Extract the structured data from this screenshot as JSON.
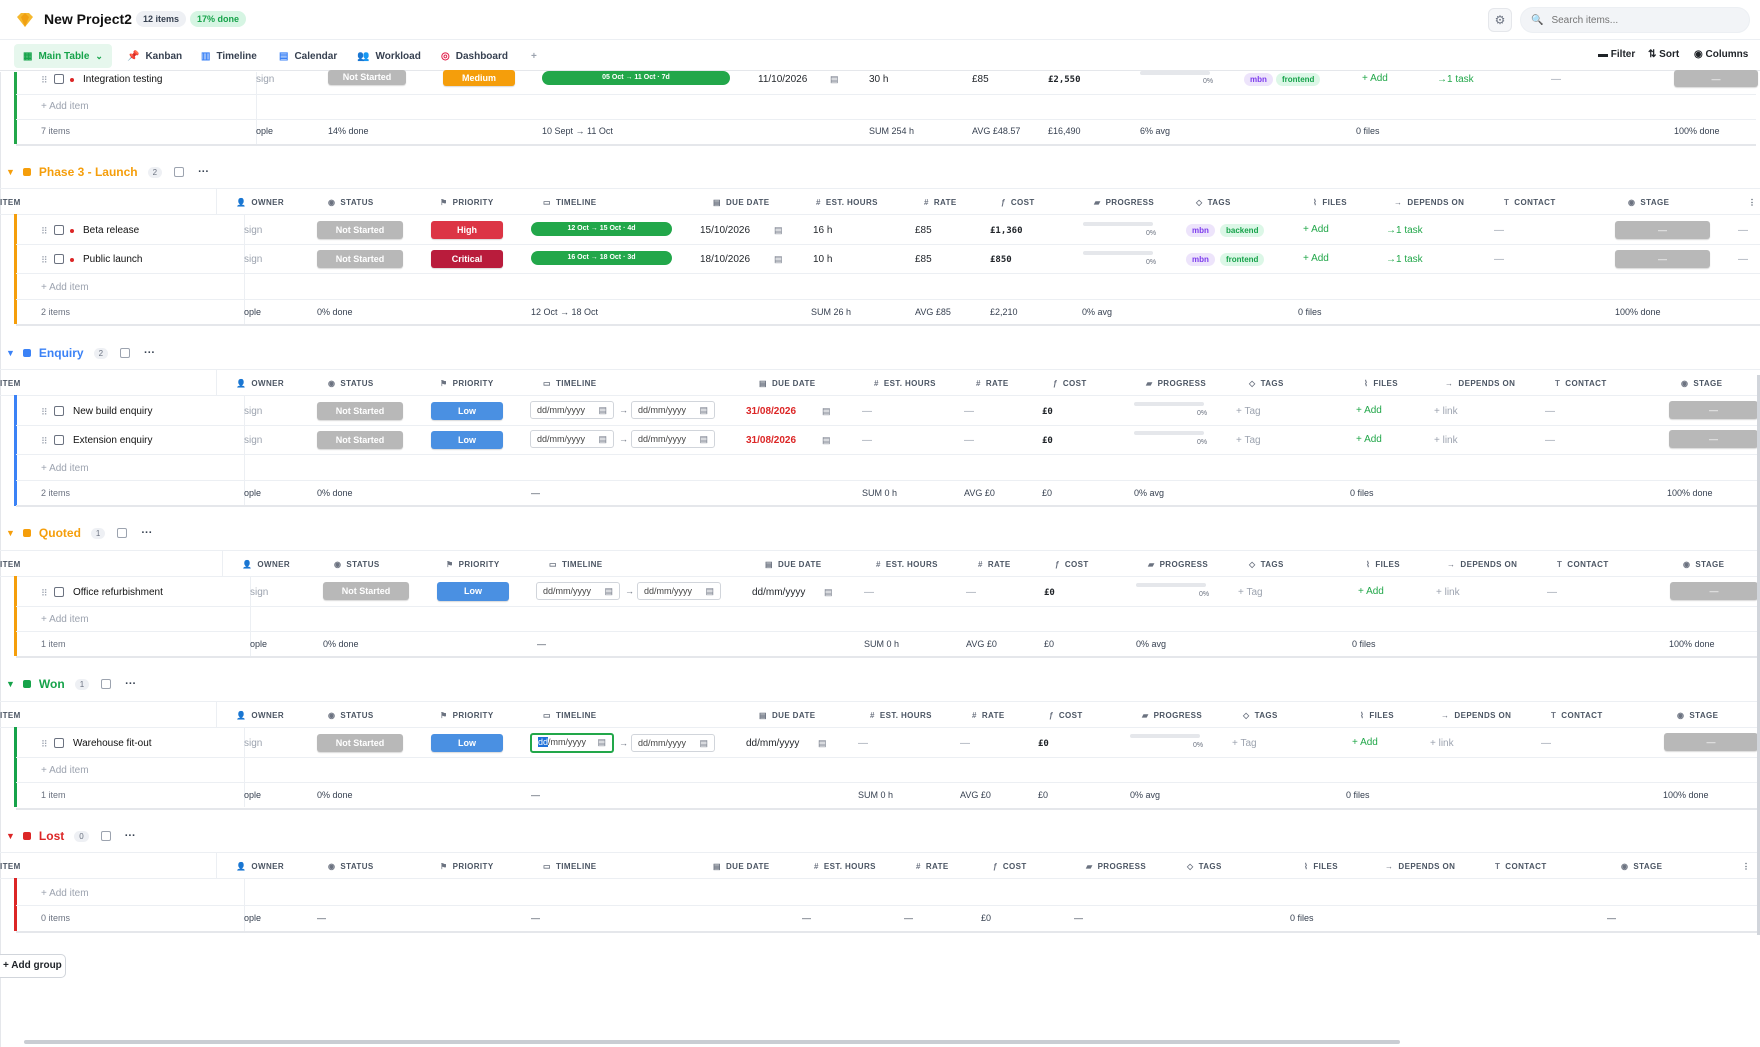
{
  "project": {
    "title": "New Project2",
    "item_count": "12 items",
    "done": "17% done"
  },
  "search": {
    "placeholder": "Search items..."
  },
  "tabs": [
    {
      "label": "Main Table",
      "icon": "table-icon"
    },
    {
      "label": "Kanban",
      "icon": "pin-icon"
    },
    {
      "label": "Timeline",
      "icon": "bar-chart-icon"
    },
    {
      "label": "Calendar",
      "icon": "calendar-icon"
    },
    {
      "label": "Workload",
      "icon": "people-icon"
    },
    {
      "label": "Dashboard",
      "icon": "target-icon"
    }
  ],
  "toolbar": {
    "filter": "Filter",
    "sort": "Sort",
    "columns": "Columns",
    "add_tab": "+"
  },
  "columns": {
    "item": "ITEM",
    "owner": "OWNER",
    "status": "STATUS",
    "priority": "PRIORITY",
    "timeline": "TIMELINE",
    "due_date": "DUE DATE",
    "est_hours": "EST. HOURS",
    "rate": "RATE",
    "cost": "COST",
    "progress": "PROGRESS",
    "tags": "TAGS",
    "files": "FILES",
    "depends_on": "DEPENDS ON",
    "contact": "CONTACT",
    "stage": "STAGE"
  },
  "common": {
    "add_item": "+ Add item",
    "assign": "sign",
    "people": "ople",
    "dash": "—",
    "add_tag": "+ Tag",
    "add_file": "+ Add",
    "add_link": "+ link",
    "date_placeholder": "dd/mm/yyyy",
    "date_placeholder_focus_sel": "dd",
    "date_placeholder_focus_rest": "/mm/yyyy",
    "arrow": "→",
    "pct0": "0%"
  },
  "phase2": {
    "item": {
      "name": "Integration testing",
      "status": "Not Started",
      "priority": "Medium",
      "timeline": "05 Oct → 11 Oct · 7d",
      "due": "11/10/2026",
      "hours": "30 h",
      "rate": "£85",
      "cost": "£2,550",
      "progress": "0%",
      "tags": [
        "mbn",
        "frontend"
      ],
      "files": "+ Add",
      "depends": "→1 task",
      "contact": "—",
      "stage": "—"
    },
    "summary": {
      "count": "7 items",
      "done": "14% done",
      "timeline": "10 Sept → 11 Oct",
      "hours": "SUM 254 h",
      "rate": "AVG £48.57",
      "cost": "£16,490",
      "progress": "6% avg",
      "files": "0 files",
      "stage": "100% done"
    }
  },
  "groups": [
    {
      "name": "Phase 3 - Launch",
      "count": "2",
      "color": "#f59e0b",
      "items": [
        {
          "name": "Beta release",
          "status": "Not Started",
          "priority": "High",
          "timeline": "12 Oct → 15 Oct · 4d",
          "due": "15/10/2026",
          "hours": "16 h",
          "rate": "£85",
          "cost": "£1,360",
          "progress": "0%",
          "tags": [
            "mbn",
            "backend"
          ],
          "files": "+ Add",
          "depends": "→1 task",
          "contact": "—",
          "stage": "—",
          "extra": "—"
        },
        {
          "name": "Public launch",
          "status": "Not Started",
          "priority": "Critical",
          "timeline": "16 Oct → 18 Oct · 3d",
          "due": "18/10/2026",
          "hours": "10 h",
          "rate": "£85",
          "cost": "£850",
          "progress": "0%",
          "tags": [
            "mbn",
            "frontend"
          ],
          "files": "+ Add",
          "depends": "→1 task",
          "contact": "—",
          "stage": "—",
          "extra": "—"
        }
      ],
      "summary": {
        "count": "2 items",
        "done": "0% done",
        "timeline": "12 Oct → 18 Oct",
        "hours": "SUM 26 h",
        "rate": "AVG £85",
        "cost": "£2,210",
        "progress": "0% avg",
        "files": "0 files",
        "stage": "100% done"
      }
    },
    {
      "name": "Enquiry",
      "count": "2",
      "color": "#3b82f6",
      "items": [
        {
          "name": "New build enquiry",
          "status": "Not Started",
          "priority": "Low",
          "due": "31/08/2026",
          "cost": "£0",
          "progress": "0%"
        },
        {
          "name": "Extension enquiry",
          "status": "Not Started",
          "priority": "Low",
          "due": "31/08/2026",
          "cost": "£0",
          "progress": "0%"
        }
      ],
      "summary": {
        "count": "2 items",
        "done": "0% done",
        "timeline": "—",
        "hours": "SUM 0 h",
        "rate": "AVG £0",
        "cost": "£0",
        "progress": "0% avg",
        "files": "0 files",
        "stage": "100% done"
      }
    },
    {
      "name": "Quoted",
      "count": "1",
      "color": "#f59e0b",
      "items": [
        {
          "name": "Office refurbishment",
          "status": "Not Started",
          "priority": "Low",
          "due": "dd/mm/yyyy",
          "cost": "£0",
          "progress": "0%"
        }
      ],
      "summary": {
        "count": "1 item",
        "done": "0% done",
        "timeline": "—",
        "hours": "SUM 0 h",
        "rate": "AVG £0",
        "cost": "£0",
        "progress": "0% avg",
        "files": "0 files",
        "stage": "100% done"
      }
    },
    {
      "name": "Won",
      "count": "1",
      "color": "#16a34a",
      "items": [
        {
          "name": "Warehouse fit-out",
          "status": "Not Started",
          "priority": "Low",
          "due": "dd/mm/yyyy",
          "cost": "£0",
          "progress": "0%"
        }
      ],
      "summary": {
        "count": "1 item",
        "done": "0% done",
        "timeline": "—",
        "hours": "SUM 0 h",
        "rate": "AVG £0",
        "cost": "£0",
        "progress": "0% avg",
        "files": "0 files",
        "stage": "100% done"
      }
    },
    {
      "name": "Lost",
      "count": "0",
      "color": "#dc2626",
      "items": [],
      "summary": {
        "count": "0 items",
        "done": "—",
        "timeline": "—",
        "hours": "—",
        "rate": "—",
        "cost": "£0",
        "progress": "—",
        "files": "0 files",
        "stage": "—"
      }
    }
  ],
  "add_group": "+ Add group",
  "colors": {
    "accent": "#22a74a",
    "high": "#dc3545",
    "critical": "#b91c3c",
    "low": "#4a90e2",
    "medium": "#f59e0b",
    "status_gray": "#b8b8b8"
  }
}
